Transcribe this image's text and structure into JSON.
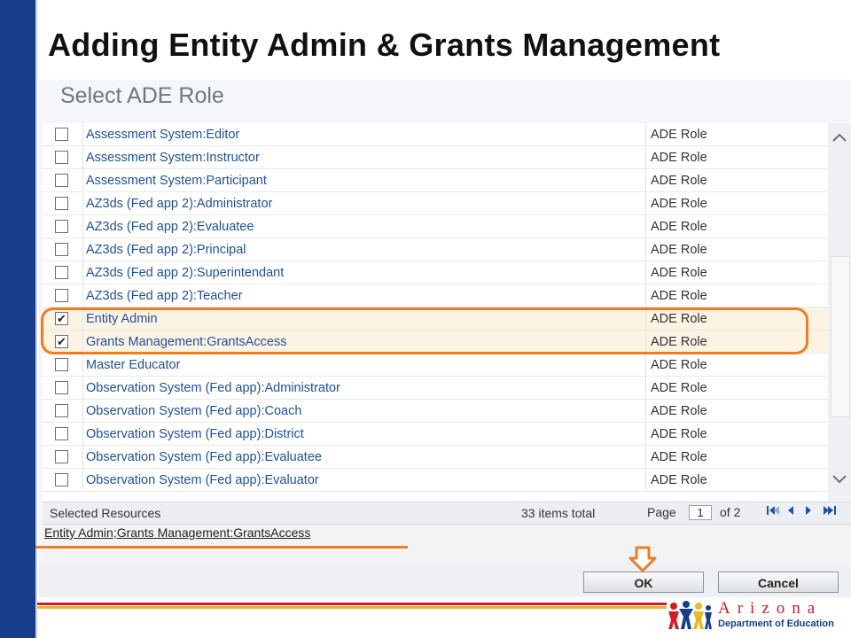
{
  "slide": {
    "title": "Adding Entity Admin & Grants Management"
  },
  "dialog": {
    "title": "Select ADE Role",
    "rows": [
      {
        "name": "Assessment System:Editor",
        "type": "ADE Role",
        "checked": false
      },
      {
        "name": "Assessment System:Instructor",
        "type": "ADE Role",
        "checked": false
      },
      {
        "name": "Assessment System:Participant",
        "type": "ADE Role",
        "checked": false
      },
      {
        "name": "AZ3ds (Fed app 2):Administrator",
        "type": "ADE Role",
        "checked": false
      },
      {
        "name": "AZ3ds (Fed app 2):Evaluatee",
        "type": "ADE Role",
        "checked": false
      },
      {
        "name": "AZ3ds (Fed app 2):Principal",
        "type": "ADE Role",
        "checked": false
      },
      {
        "name": "AZ3ds (Fed app 2):Superintendant",
        "type": "ADE Role",
        "checked": false
      },
      {
        "name": "AZ3ds (Fed app 2):Teacher",
        "type": "ADE Role",
        "checked": false
      },
      {
        "name": "Entity Admin",
        "type": "ADE Role",
        "checked": true
      },
      {
        "name": "Grants Management:GrantsAccess",
        "type": "ADE Role",
        "checked": true
      },
      {
        "name": "Master Educator",
        "type": "ADE Role",
        "checked": false
      },
      {
        "name": "Observation System (Fed app):Administrator",
        "type": "ADE Role",
        "checked": false
      },
      {
        "name": "Observation System (Fed app):Coach",
        "type": "ADE Role",
        "checked": false
      },
      {
        "name": "Observation System (Fed app):District",
        "type": "ADE Role",
        "checked": false
      },
      {
        "name": "Observation System (Fed app):Evaluatee",
        "type": "ADE Role",
        "checked": false
      },
      {
        "name": "Observation System (Fed app):Evaluator",
        "type": "ADE Role",
        "checked": false
      }
    ],
    "footer": {
      "selected_label": "Selected Resources",
      "items_total": "33 items total",
      "page_label": "Page",
      "page_value": "1",
      "of_label": "of 2"
    },
    "selected_resources": "Entity Admin;Grants Management:GrantsAccess",
    "ok_label": "OK",
    "cancel_label": "Cancel"
  },
  "logo": {
    "word": "Arizona",
    "sub": "Department of Education"
  },
  "colors": {
    "accent_orange": "#ee7d22",
    "side_bar_blue": "#163e8c",
    "link_blue": "#1f4f9a"
  }
}
